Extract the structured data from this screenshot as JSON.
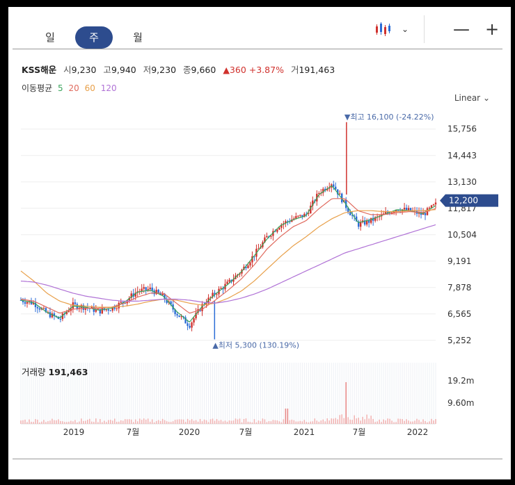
{
  "tabs": [
    {
      "label": "일"
    },
    {
      "label": "주"
    },
    {
      "label": "월"
    }
  ],
  "toolbar": {
    "chart_type_icon": "candlestick-icon",
    "dropdown_icon": "chevron-down-icon",
    "zoom_out": "—",
    "zoom_in": "+"
  },
  "quote": {
    "name": "KSS해운",
    "open_label": "시",
    "open": "9,230",
    "high_label": "고",
    "high": "9,940",
    "low_label": "저",
    "low": "9,230",
    "close_label": "종",
    "close": "9,660",
    "change": "▲360 +3.87%",
    "volume_label": "거",
    "volume": "191,463"
  },
  "ma": {
    "label": "이동평균",
    "p5": "5",
    "p20": "20",
    "p60": "60",
    "p120": "120"
  },
  "scale": {
    "label": "Linear"
  },
  "price_axis": [
    "15,756",
    "14,443",
    "13,130",
    "11,817",
    "10,504",
    "9,191",
    "7,878",
    "6,565",
    "5,252"
  ],
  "current_price": "12,200",
  "max_marker": "▼최고 16,100 (-24.22%)",
  "min_marker": "▲최저 5,300 (130.19%)",
  "volume_panel": {
    "title": "거래량",
    "value": "191,463",
    "axis": [
      "19.2m",
      "9.60m"
    ]
  },
  "x_axis": [
    "2019",
    "7월",
    "2020",
    "7월",
    "2021",
    "7월",
    "2022"
  ],
  "colors": {
    "up": "#d0312d",
    "down": "#2b6cd6",
    "ma5": "#3ba55c",
    "ma20": "#e06a5e",
    "ma60": "#e8a04a",
    "ma120": "#b072d6",
    "accent": "#2d4c8e"
  },
  "chart_data": {
    "type": "line",
    "yaxis_range": [
      4900,
      16300
    ],
    "x": [
      "2019",
      "7월",
      "2020",
      "7월",
      "2021",
      "7월",
      "2022"
    ],
    "series": [
      {
        "name": "",
        "values": [
          7250,
          7100,
          6600,
          6300,
          7000,
          6900,
          6700,
          6850,
          7200,
          7700,
          7800,
          7400,
          6600,
          6000,
          7000,
          7600,
          8100,
          8700,
          9500,
          10400,
          11000,
          11300,
          11500,
          12600,
          13100,
          12000,
          11000,
          11200,
          11500,
          11800,
          11700,
          11500,
          12000
        ]
      },
      {
        "name": "5",
        "values": [
          7250,
          7120,
          6650,
          6350,
          6950,
          6900,
          6750,
          6850,
          7150,
          7650,
          7750,
          7450,
          6700,
          6150,
          6950,
          7550,
          8050,
          8650,
          9450,
          10300,
          10950,
          11250,
          11450,
          12500,
          12950,
          12100,
          11100,
          11250,
          11500,
          11750,
          11700,
          11550,
          11950
        ]
      },
      {
        "name": "20",
        "values": [
          7300,
          7200,
          6900,
          6600,
          6800,
          6850,
          6850,
          6900,
          7100,
          7400,
          7600,
          7600,
          7100,
          6600,
          6800,
          7250,
          7750,
          8300,
          9000,
          9800,
          10400,
          10900,
          11200,
          11800,
          12300,
          12300,
          11700,
          11500,
          11500,
          11600,
          11650,
          11600,
          11800
        ]
      },
      {
        "name": "60",
        "values": [
          8700,
          8200,
          7600,
          7200,
          7000,
          6950,
          6900,
          6900,
          6950,
          7050,
          7200,
          7300,
          7250,
          7100,
          7000,
          7100,
          7350,
          7700,
          8200,
          8800,
          9400,
          9950,
          10400,
          10900,
          11300,
          11600,
          11700,
          11700,
          11650,
          11650,
          11700,
          11700,
          11750
        ]
      },
      {
        "name": "120",
        "values": [
          8200,
          8150,
          8000,
          7800,
          7600,
          7450,
          7350,
          7250,
          7200,
          7200,
          7250,
          7300,
          7300,
          7250,
          7150,
          7100,
          7200,
          7350,
          7550,
          7800,
          8100,
          8400,
          8700,
          9000,
          9300,
          9600,
          9800,
          10000,
          10200,
          10400,
          10600,
          10800,
          11000
        ]
      }
    ],
    "max": 16100,
    "min": 5300,
    "current": 12200
  }
}
